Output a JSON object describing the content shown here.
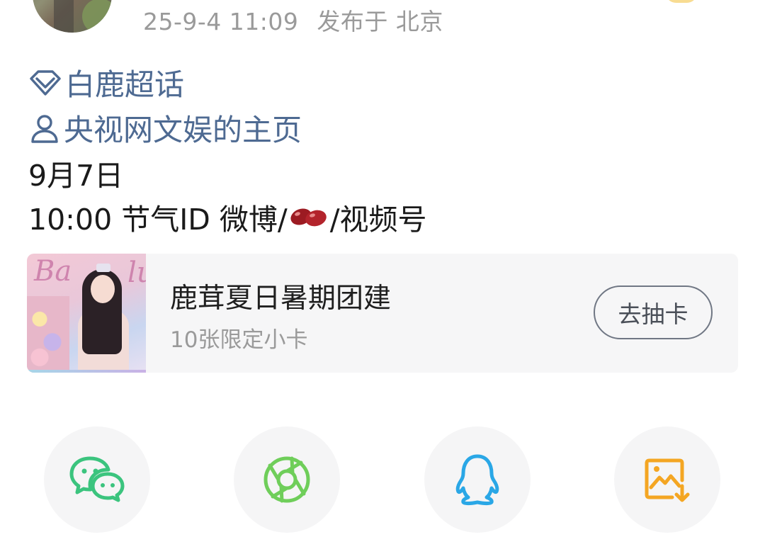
{
  "post": {
    "timestamp": "25-9-4 11:09",
    "location": "发布于 北京"
  },
  "links": {
    "supertopic": "白鹿超话",
    "homepage": "央视网文娱的主页"
  },
  "content": {
    "line1": "9月7日",
    "line2_prefix": "10:00 节气ID  微博/",
    "line2_suffix": "/视频号"
  },
  "card": {
    "title": "鹿茸夏日暑期团建",
    "subtitle": "10张限定小卡",
    "button": "去抽卡",
    "thumb_text_left": "Ba",
    "thumb_text_right": "lu"
  },
  "share": {
    "items": [
      {
        "icon": "wechat-icon",
        "color": "#3bc47e"
      },
      {
        "icon": "moments-icon",
        "color": "#6fce5a"
      },
      {
        "icon": "qq-icon",
        "color": "#2aa7e6"
      },
      {
        "icon": "save-image-icon",
        "color": "#f4a623"
      }
    ]
  },
  "colors": {
    "link": "#4e6a92",
    "meta": "#9a9a9a",
    "card_bg": "#f6f6f7"
  }
}
